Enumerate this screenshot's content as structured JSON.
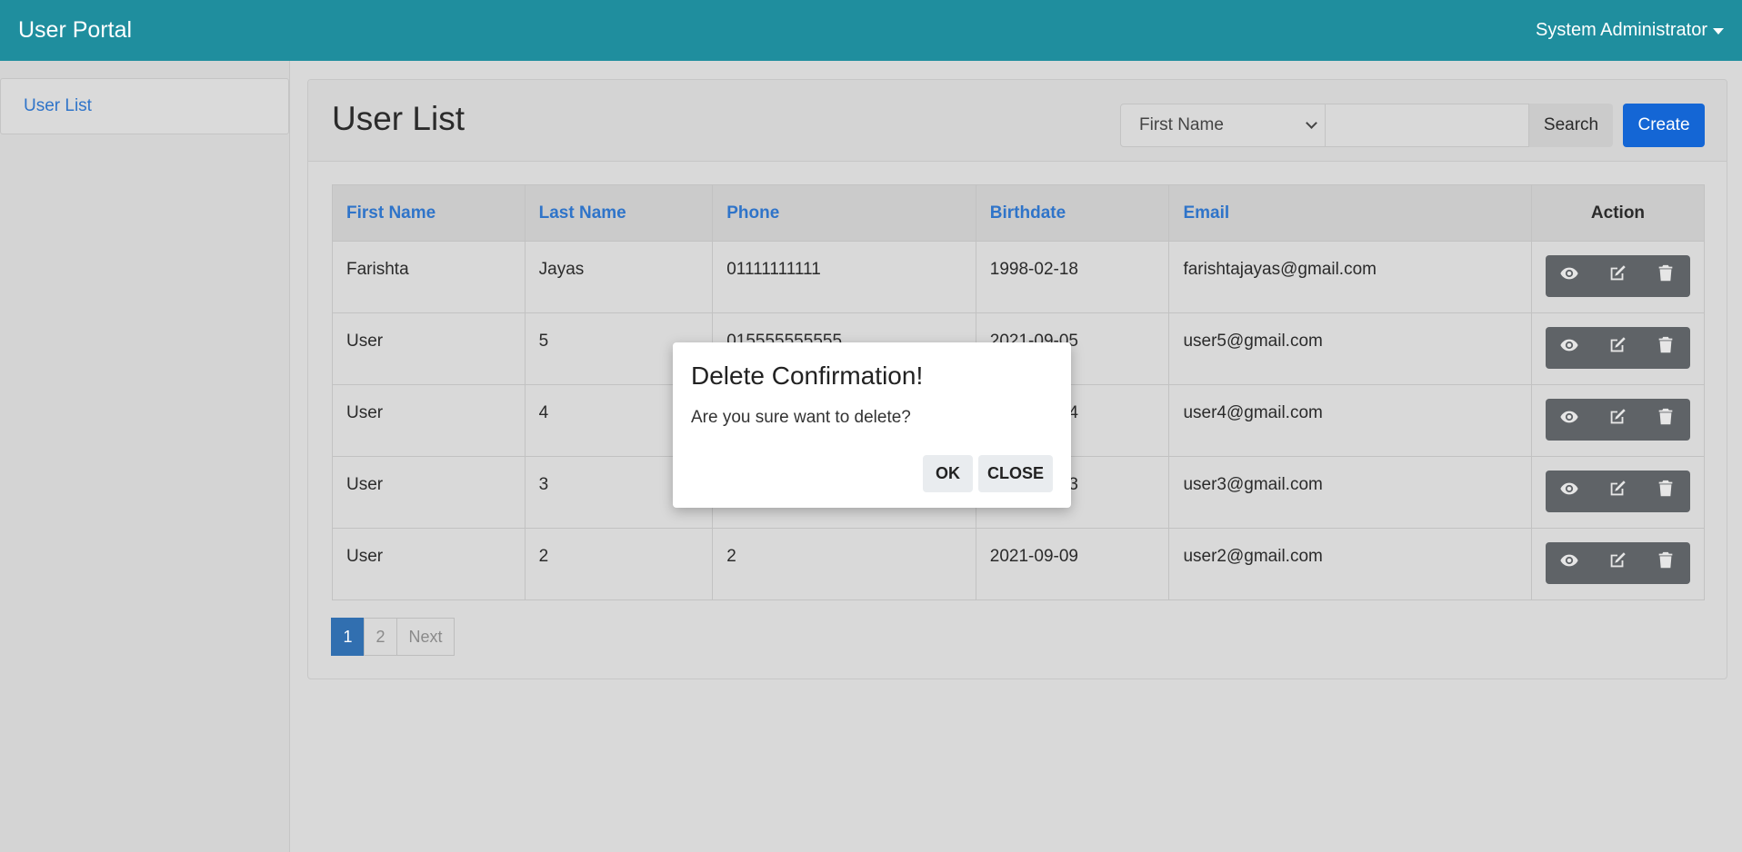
{
  "app": {
    "title": "User Portal",
    "user_menu": "System Administrator"
  },
  "sidebar": {
    "items": [
      {
        "label": "User List"
      }
    ]
  },
  "page": {
    "title": "User List"
  },
  "search": {
    "field_selected": "First Name",
    "value": "",
    "button": "Search"
  },
  "create_label": "Create",
  "table": {
    "headers": {
      "first_name": "First Name",
      "last_name": "Last Name",
      "phone": "Phone",
      "birthdate": "Birthdate",
      "email": "Email",
      "action": "Action"
    },
    "rows": [
      {
        "first_name": "Farishta",
        "last_name": "Jayas",
        "phone": "01111111111",
        "birthdate": "1998-02-18",
        "email": "farishtajayas@gmail.com"
      },
      {
        "first_name": "User",
        "last_name": "5",
        "phone": "015555555555",
        "birthdate": "2021-09-05",
        "email": "user5@gmail.com"
      },
      {
        "first_name": "User",
        "last_name": "4",
        "phone": "",
        "birthdate": "2021-09-04",
        "email": "user4@gmail.com"
      },
      {
        "first_name": "User",
        "last_name": "3",
        "phone": "",
        "birthdate": "2021-09-03",
        "email": "user3@gmail.com"
      },
      {
        "first_name": "User",
        "last_name": "2",
        "phone": "2",
        "birthdate": "2021-09-09",
        "email": "user2@gmail.com"
      }
    ]
  },
  "pagination": {
    "pages": [
      "1",
      "2"
    ],
    "current": "1",
    "next": "Next"
  },
  "dialog": {
    "title": "Delete Confirmation!",
    "message": "Are you sure want to delete?",
    "ok": "OK",
    "close": "CLOSE"
  }
}
